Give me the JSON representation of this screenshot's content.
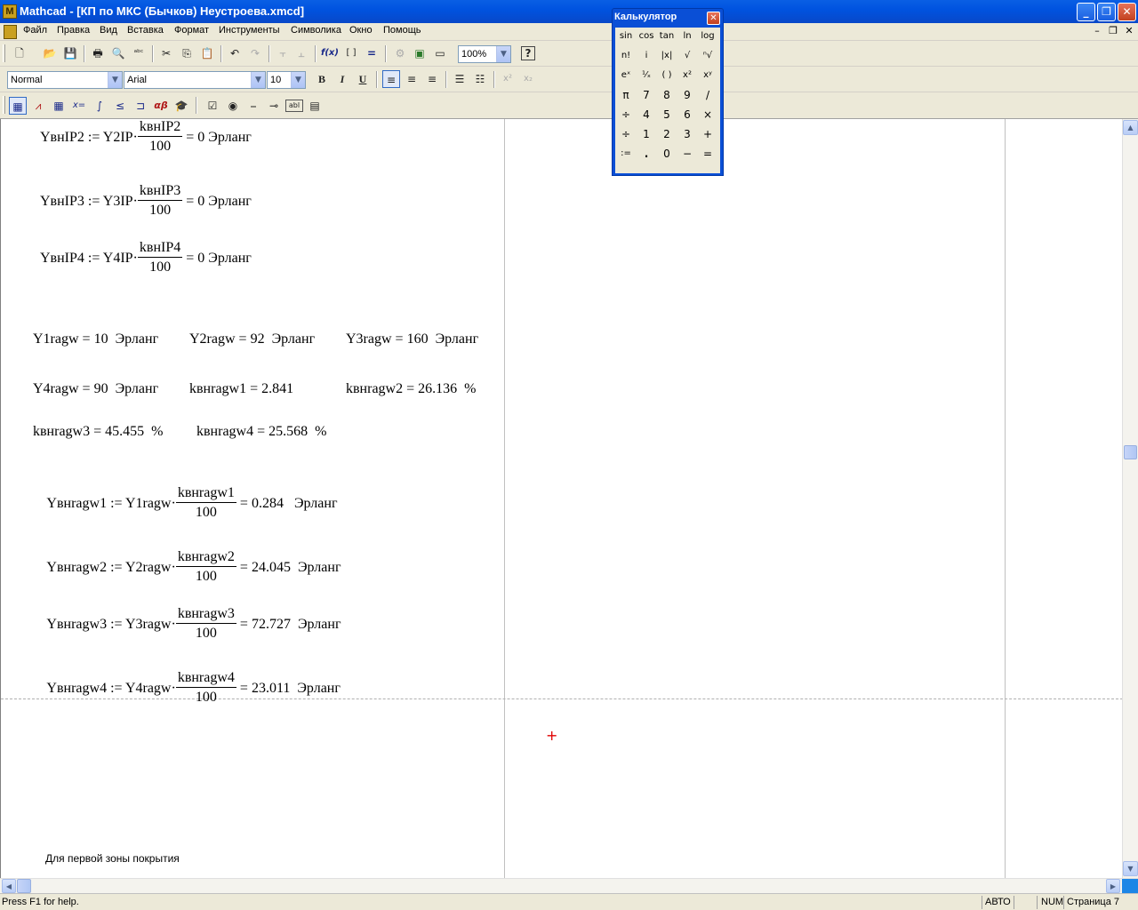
{
  "window": {
    "title": "Mathcad - [КП по МКС (Бычков) Неустроева.xmcd]",
    "logo": "M",
    "buttons": {
      "minimize": "_",
      "restore": "❐",
      "close": "✕"
    }
  },
  "menu": [
    "Файл",
    "Правка",
    "Вид",
    "Вставка",
    "Формат",
    "Инструменты",
    "Символика",
    "Окно",
    "Помощь"
  ],
  "mdi_buttons": [
    "–",
    "❐",
    "✕"
  ],
  "toolbar1": {
    "icons": [
      "new-icon",
      "open-icon",
      "save-icon",
      "print-icon",
      "print-preview-icon",
      "spellcheck-icon",
      "cut-icon",
      "copy-icon",
      "paste-icon",
      "undo-icon",
      "redo-icon",
      "align-top-icon",
      "align-bottom-icon",
      "insert-function-icon",
      "insert-unit-icon",
      "calculate-icon",
      "resource-icon",
      "component-icon",
      "region-icon",
      "help-icon"
    ],
    "glyphs": [
      "🗋",
      "📂",
      "💾",
      "🖶",
      "🔍",
      "ᵃᵇᶜ",
      "✂",
      "⎘",
      "📋",
      "↶",
      "↷",
      "⫟",
      "⫠",
      "f(x)",
      "[ ]",
      "=",
      "⚙",
      "▣",
      "▭",
      "?"
    ],
    "zoom": "100%"
  },
  "toolbar2": {
    "style": "Normal",
    "font": "Arial",
    "size": "10",
    "format": [
      "B",
      "I",
      "U"
    ],
    "align": [
      "≡",
      "≡",
      "≡"
    ],
    "lists": [
      "☰",
      "☷"
    ],
    "scripts": [
      "x²",
      "x₂"
    ]
  },
  "toolbar3": {
    "glyphs": [
      "▦",
      "⩘",
      "▦",
      "x=",
      "∫",
      "≤",
      "⊐",
      "αβ",
      "🎓",
      "☑",
      "◉",
      "⎯",
      "⊸",
      "abl",
      "▤"
    ]
  },
  "document": {
    "lines": [
      {
        "lhs": "YвнIP2 := Y2IP·",
        "num": "kвнIP2",
        "den": "100",
        "rhs": "= 0 Эрланг"
      },
      {
        "lhs": "YвнIP3 := Y3IP·",
        "num": "kвнIP3",
        "den": "100",
        "rhs": "= 0 Эрланг"
      },
      {
        "lhs": "YвнIP4 := Y4IP·",
        "num": "kвнIP4",
        "den": "100",
        "rhs": "= 0 Эрланг"
      }
    ],
    "row1": [
      "Y1ragw = 10  Эрланг",
      "Y2ragw = 92  Эрланг",
      "Y3ragw = 160  Эрланг"
    ],
    "row2": [
      "Y4ragw = 90  Эрланг",
      "kвнragw1 = 2.841",
      "kвнragw2 = 26.136  %"
    ],
    "row3": [
      "kвнragw3 = 45.455  %",
      "kвнragw4 = 25.568  %"
    ],
    "formulas": [
      {
        "lhs": "Yвнragw1 := Y1ragw·",
        "num": "kвнragw1",
        "den": "100",
        "rhs": "= 0.284   Эрланг"
      },
      {
        "lhs": "Yвнragw2 := Y2ragw·",
        "num": "kвнragw2",
        "den": "100",
        "rhs": "= 24.045  Эрланг"
      },
      {
        "lhs": "Yвнragw3 := Y3ragw·",
        "num": "kвнragw3",
        "den": "100",
        "rhs": "= 72.727  Эрланг"
      },
      {
        "lhs": "Yвнragw4 := Y4ragw·",
        "num": "kвнragw4",
        "den": "100",
        "rhs": "= 23.011  Эрланг"
      }
    ],
    "note": "Для первой зоны покрытия",
    "cursor": "+"
  },
  "calculator": {
    "title": "Калькулятор",
    "close": "✕",
    "rows": [
      [
        "sin",
        "cos",
        "tan",
        "ln",
        "log"
      ],
      [
        "n!",
        "i",
        "|x|",
        "√",
        "ⁿ√"
      ],
      [
        "eˣ",
        "¹⁄ₓ",
        "( )",
        "x²",
        "xʸ"
      ],
      [
        "π",
        "7",
        "8",
        "9",
        "/"
      ],
      [
        "÷",
        "4",
        "5",
        "6",
        "×"
      ],
      [
        "÷",
        "1",
        "2",
        "3",
        "+"
      ],
      [
        ":=",
        ".",
        "0",
        "−",
        "="
      ]
    ]
  },
  "status": {
    "help": "Press F1 for help.",
    "mode": "АВТО",
    "num": "NUM",
    "page": "Страница 7"
  }
}
